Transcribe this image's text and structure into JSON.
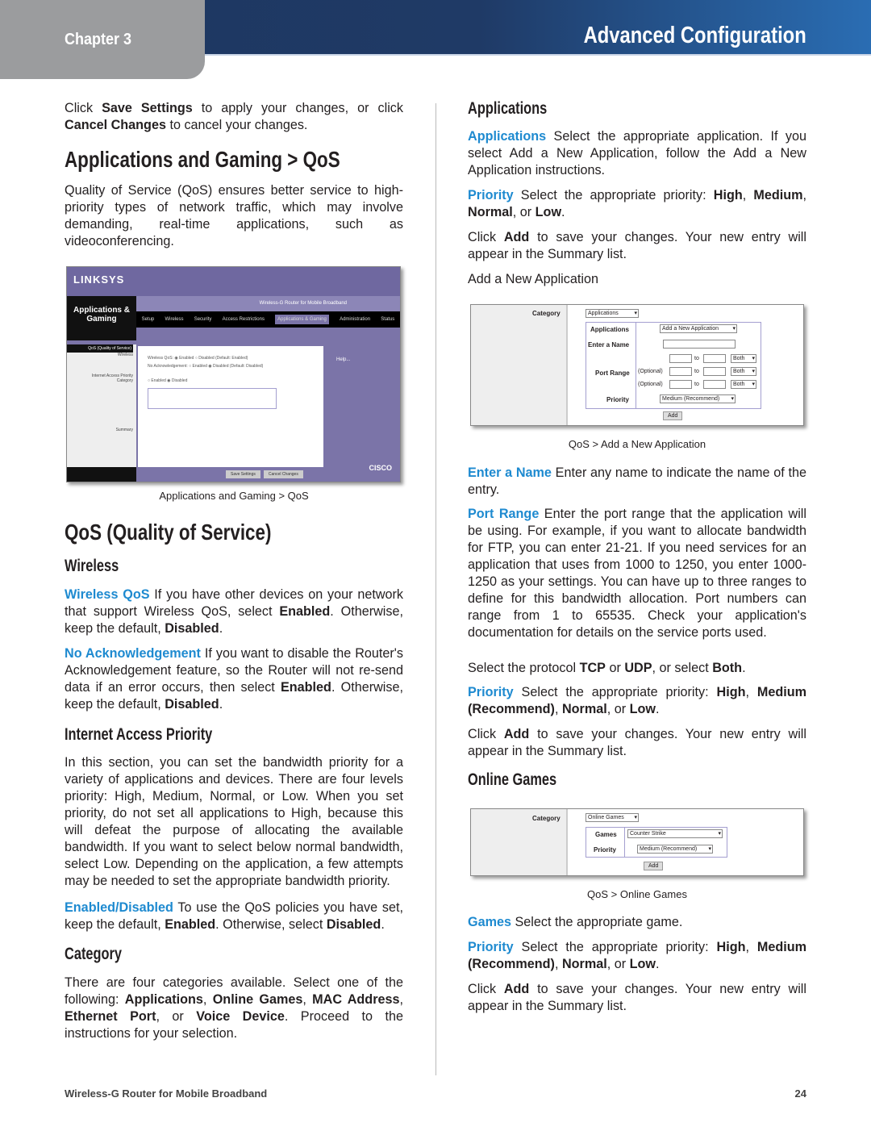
{
  "header": {
    "chapter": "Chapter 3",
    "title": "Advanced Configuration"
  },
  "left": {
    "p_save": [
      {
        "t": "Click "
      },
      {
        "t": "Save Settings",
        "b": 1
      },
      {
        "t": " to apply your changes, or click "
      },
      {
        "t": "Cancel Changes",
        "b": 1
      },
      {
        "t": " to cancel your changes."
      }
    ],
    "h_main": "Applications and Gaming > QoS",
    "p_intro": [
      {
        "t": "Quality of Service (QoS) ensures better service to high-priority types of network traffic, which may involve demanding, real-time applications, such as videoconferencing."
      }
    ],
    "fig1_caption": "Applications and Gaming > QoS",
    "h_qos": "QoS (Quality of Service)",
    "h_wireless": "Wireless",
    "p_wqos": [
      {
        "t": "Wireless QoS",
        "k": 1
      },
      {
        "t": "  If you have other devices on your network that support Wireless QoS, select "
      },
      {
        "t": "Enabled",
        "b": 1
      },
      {
        "t": ". Otherwise, keep the default, "
      },
      {
        "t": "Disabled",
        "b": 1
      },
      {
        "t": "."
      }
    ],
    "p_noack": [
      {
        "t": "No Acknowledgement",
        "k": 1
      },
      {
        "t": "  If you want to disable the Router's Acknowledgement feature, so the Router will not re-send data if an error occurs, then select "
      },
      {
        "t": "Enabled",
        "b": 1
      },
      {
        "t": ". Otherwise, keep the default, "
      },
      {
        "t": "Disabled",
        "b": 1
      },
      {
        "t": "."
      }
    ],
    "h_iap": "Internet Access Priority",
    "p_iap": [
      {
        "t": "In this section, you can set the bandwidth priority for a variety of applications and devices. There are four levels priority: High, Medium, Normal, or Low. When you set priority, do not set all applications to High, because this will defeat the purpose of allocating the available bandwidth. If you want to select below normal bandwidth, select Low. Depending on the application, a few attempts may be needed to set the appropriate bandwidth priority."
      }
    ],
    "p_ed": [
      {
        "t": "Enabled/Disabled",
        "k": 1
      },
      {
        "t": "  To use the QoS policies you have set, keep the default, "
      },
      {
        "t": "Enabled",
        "b": 1
      },
      {
        "t": ". Otherwise, select "
      },
      {
        "t": "Disabled",
        "b": 1
      },
      {
        "t": "."
      }
    ],
    "h_cat": "Category",
    "p_cat": [
      {
        "t": "There are four categories available. Select one of the following: "
      },
      {
        "t": "Applications",
        "b": 1
      },
      {
        "t": ", "
      },
      {
        "t": "Online Games",
        "b": 1
      },
      {
        "t": ", "
      },
      {
        "t": "MAC Address",
        "b": 1
      },
      {
        "t": ", "
      },
      {
        "t": "Ethernet Port",
        "b": 1
      },
      {
        "t": ", or "
      },
      {
        "t": "Voice Device",
        "b": 1
      },
      {
        "t": ". Proceed to the instructions for your selection."
      }
    ]
  },
  "right": {
    "h_apps": "Applications",
    "p_apps": [
      {
        "t": "Applications",
        "k": 1
      },
      {
        "t": "  Select the appropriate application. If you select Add a New Application, follow the Add a New Application instructions."
      }
    ],
    "p_prio1": [
      {
        "t": "Priority",
        "k": 1
      },
      {
        "t": "  Select the appropriate priority: "
      },
      {
        "t": "High",
        "b": 1
      },
      {
        "t": ", "
      },
      {
        "t": "Medium",
        "b": 1
      },
      {
        "t": ", "
      },
      {
        "t": "Normal",
        "b": 1
      },
      {
        "t": ", or "
      },
      {
        "t": "Low",
        "b": 1
      },
      {
        "t": "."
      }
    ],
    "p_add1": [
      {
        "t": "Click "
      },
      {
        "t": "Add",
        "b": 1
      },
      {
        "t": " to save your changes. Your new entry will appear in the Summary list."
      }
    ],
    "p_addnew": [
      {
        "t": "Add a New Application"
      }
    ],
    "fig2_caption": "QoS > Add a New Application",
    "p_name": [
      {
        "t": "Enter a Name",
        "k": 1
      },
      {
        "t": "  Enter any name to indicate the name of the entry."
      }
    ],
    "p_port": [
      {
        "t": "Port Range",
        "k": 1
      },
      {
        "t": "  Enter the port range that the application will be using. For example, if you want to allocate bandwidth for FTP, you can enter 21-21. If you need services for an application that uses from 1000 to 1250, you enter 1000-1250 as your settings. You can have up to three ranges to define for this bandwidth allocation. Port numbers can range from 1 to 65535. Check your application's documentation for details on the service ports used."
      }
    ],
    "p_proto": [
      {
        "t": "Select the protocol "
      },
      {
        "t": "TCP",
        "b": 1
      },
      {
        "t": " or "
      },
      {
        "t": "UDP",
        "b": 1
      },
      {
        "t": ", or select "
      },
      {
        "t": "Both",
        "b": 1
      },
      {
        "t": "."
      }
    ],
    "p_prio2": [
      {
        "t": "Priority",
        "k": 1
      },
      {
        "t": "  Select the appropriate priority: "
      },
      {
        "t": "High",
        "b": 1
      },
      {
        "t": ", "
      },
      {
        "t": "Medium (Recommend)",
        "b": 1
      },
      {
        "t": ", "
      },
      {
        "t": "Normal",
        "b": 1
      },
      {
        "t": ", or "
      },
      {
        "t": "Low",
        "b": 1
      },
      {
        "t": "."
      }
    ],
    "p_add2": [
      {
        "t": "Click "
      },
      {
        "t": "Add",
        "b": 1
      },
      {
        "t": " to save your changes. Your new entry will appear in the Summary list."
      }
    ],
    "h_games": "Online Games",
    "fig3_caption": "QoS > Online Games",
    "p_games": [
      {
        "t": "Games",
        "k": 1
      },
      {
        "t": "  Select the appropriate game."
      }
    ],
    "p_prio3": [
      {
        "t": "Priority",
        "k": 1
      },
      {
        "t": "  Select the appropriate priority: "
      },
      {
        "t": "High",
        "b": 1
      },
      {
        "t": ", "
      },
      {
        "t": "Medium (Recommend)",
        "b": 1
      },
      {
        "t": ", "
      },
      {
        "t": "Normal",
        "b": 1
      },
      {
        "t": ", or "
      },
      {
        "t": "Low",
        "b": 1
      },
      {
        "t": "."
      }
    ],
    "p_add3": [
      {
        "t": "Click "
      },
      {
        "t": "Add",
        "b": 1
      },
      {
        "t": " to save your changes. Your new entry will appear in the Summary list."
      }
    ]
  },
  "fig1": {
    "logo": "LINKSYS",
    "side_title": "Applications & Gaming",
    "model": "Wireless-G Router for Mobile Broadband",
    "nav": [
      "Setup",
      "Wireless",
      "Security",
      "Access Restrictions",
      "Applications & Gaming",
      "Administration",
      "Status"
    ],
    "section": "QoS (Quality of Service)",
    "labels": [
      "Wireless",
      "Internet Access Priority",
      "Category",
      "Summary"
    ],
    "wqos": "Wireless QoS:  ◉ Enabled  ○ Disabled  (Default: Enabled)",
    "noack": "No Acknowledgement:  ○ Enabled  ◉ Disabled  (Default: Disabled)",
    "iap": "○ Enabled  ◉ Disabled",
    "help": "Help...",
    "save": "Save Settings",
    "cancel": "Cancel Changes",
    "brand": "CISCO"
  },
  "fig2": {
    "category": "Category",
    "category_value": "Applications",
    "applications": "Applications",
    "app_value": "Add a New Application",
    "enter_name": "Enter a Name",
    "port_range": "Port Range",
    "optional": "(Optional)",
    "to": "to",
    "both": "Both",
    "priority": "Priority",
    "priority_value": "Medium (Recommend)",
    "add": "Add"
  },
  "fig3": {
    "category": "Category",
    "category_value": "Online Games",
    "games": "Games",
    "games_value": "Counter Strike",
    "priority": "Priority",
    "priority_value": "Medium (Recommend)",
    "add": "Add"
  },
  "footer": {
    "left": "Wireless-G Router for Mobile Broadband",
    "page": "24"
  },
  "colors": {
    "accent": "#1e8ad0",
    "header": "#1e3760",
    "chapter_tab": "#9b9c9e"
  }
}
